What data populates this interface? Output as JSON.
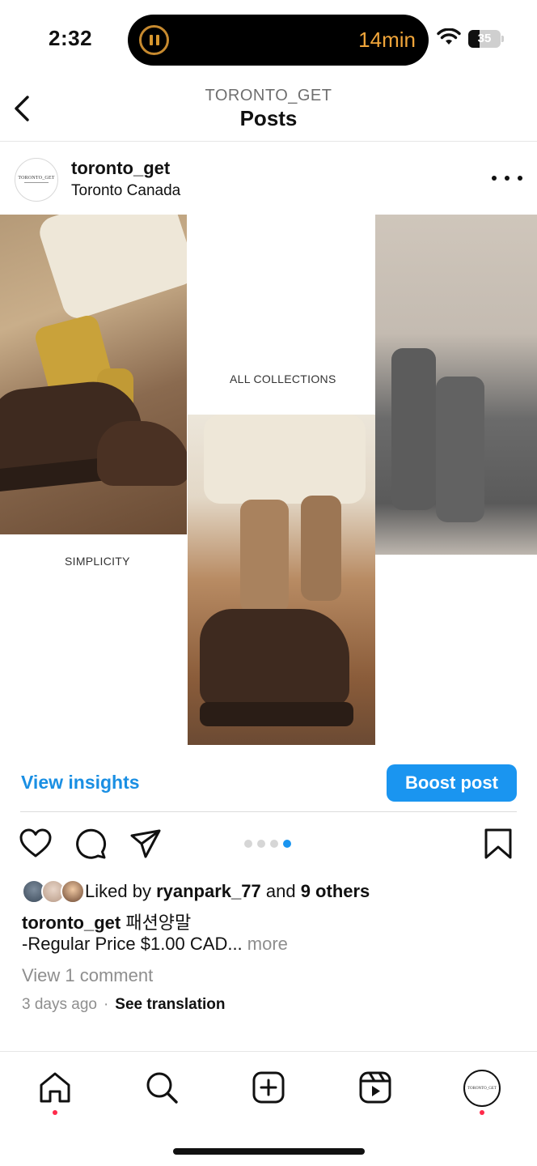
{
  "status_bar": {
    "time": "2:32",
    "live_activity_timer": "14min",
    "battery_percent": "35",
    "battery_level": 0.35
  },
  "header": {
    "subtitle": "TORONTO_GET",
    "title": "Posts"
  },
  "post": {
    "username": "toronto_get",
    "location": "Toronto Canada",
    "avatar_text": "TORONTO_GET",
    "image_captions": {
      "top_center": "ALL COLLECTIONS",
      "left": "SIMPLICITY"
    },
    "view_insights_label": "View insights",
    "boost_label": "Boost post",
    "carousel": {
      "total": 4,
      "active_index": 3
    },
    "likes": {
      "prefix": "Liked by",
      "user": "ryanpark_77",
      "joiner": "and",
      "others": "9 others"
    },
    "caption": {
      "user": "toronto_get",
      "text": "패션양말",
      "line2": "-Regular Price $1.00 CAD...",
      "more": "more"
    },
    "comments_link": "View 1 comment",
    "posted_time": "3 days ago",
    "separator": "·",
    "see_translation": "See translation"
  },
  "tab_bar": {
    "items": [
      "home-icon",
      "search-icon",
      "create-icon",
      "reels-icon",
      "profile-avatar"
    ],
    "notification_color": "#ff2a4a"
  },
  "colors": {
    "accent": "#1a95f0",
    "link": "#1a8fe3",
    "muted": "#8e8e8e",
    "island_accent": "#f0a53a"
  }
}
